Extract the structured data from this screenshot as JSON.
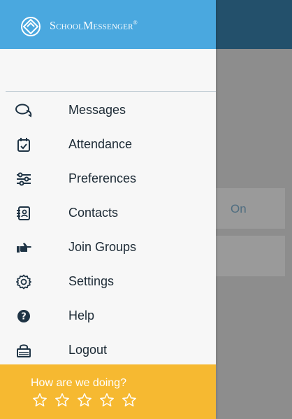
{
  "app": {
    "brand_name": "SchoolMessenger",
    "brand_symbol": "®"
  },
  "background": {
    "toggle_value": "On"
  },
  "menu": {
    "items": [
      {
        "label": "Messages",
        "icon": "chat-bubbles-icon"
      },
      {
        "label": "Attendance",
        "icon": "calendar-check-icon"
      },
      {
        "label": "Preferences",
        "icon": "sliders-icon"
      },
      {
        "label": "Contacts",
        "icon": "address-book-icon"
      },
      {
        "label": "Join Groups",
        "icon": "pointing-hand-icon"
      },
      {
        "label": "Settings",
        "icon": "gear-icon"
      },
      {
        "label": "Help",
        "icon": "question-circle-icon"
      },
      {
        "label": "Logout",
        "icon": "lock-icon"
      }
    ]
  },
  "feedback": {
    "title": "How are we doing?",
    "rating_max": 5,
    "rating_value": 0
  },
  "colors": {
    "header": "#4aa8df",
    "feedback": "#f6b931",
    "background_topbar": "#23506b"
  }
}
